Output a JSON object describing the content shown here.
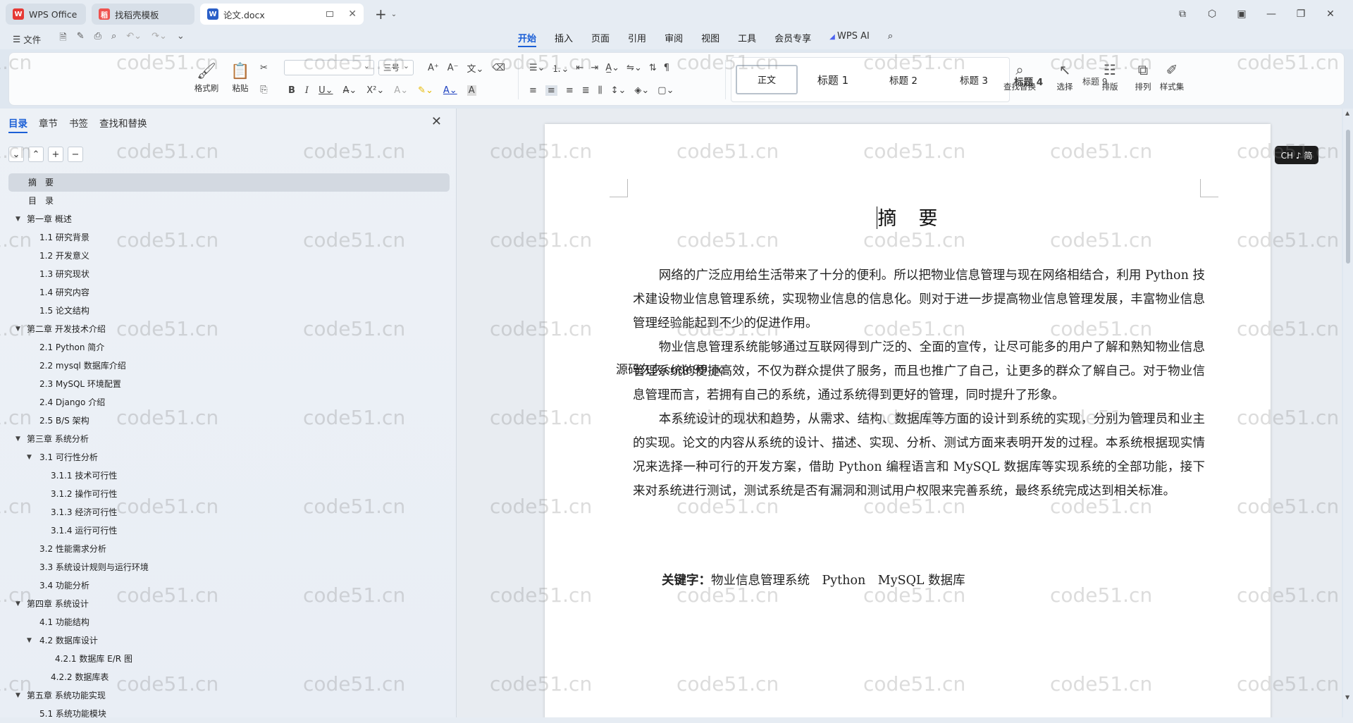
{
  "tabs": [
    {
      "label": "WPS Office",
      "icon": "wps-logo-icon"
    },
    {
      "label": "找稻壳模板",
      "icon": "daoke-logo-icon"
    },
    {
      "label": "论文.docx",
      "icon": "word-doc-icon"
    }
  ],
  "menubar": {
    "file_label": "文件",
    "menus": [
      "开始",
      "插入",
      "页面",
      "引用",
      "审阅",
      "视图",
      "工具",
      "会员专享"
    ],
    "active_menu": "开始",
    "ai_label": "WPS AI"
  },
  "ribbon": {
    "format_painter": "格式刷",
    "paste": "粘贴",
    "font_size": "三号",
    "styles": [
      "正文",
      "标题 1",
      "标题 2",
      "标题 3",
      "标题 4",
      "标题 9"
    ],
    "find_replace": "查找替换",
    "select": "选择",
    "arrange": "排版",
    "sort": "排列",
    "style_set": "样式集"
  },
  "left_panel": {
    "tabs": [
      "目录",
      "章节",
      "书签",
      "查找和替换"
    ],
    "active_tab": "目录",
    "outline": [
      {
        "label": "摘　要",
        "level": 1,
        "caret": false
      },
      {
        "label": "目　录",
        "level": 1,
        "caret": false
      },
      {
        "label": "第一章 概述",
        "level": 1,
        "caret": true
      },
      {
        "label": "1.1 研究背景",
        "level": 2,
        "caret": false
      },
      {
        "label": "1.2 开发意义",
        "level": 2,
        "caret": false
      },
      {
        "label": "1.3 研究现状",
        "level": 2,
        "caret": false
      },
      {
        "label": "1.4 研究内容",
        "level": 2,
        "caret": false
      },
      {
        "label": "1.5 论文结构",
        "level": 2,
        "caret": false
      },
      {
        "label": "第二章  开发技术介绍",
        "level": 1,
        "caret": true
      },
      {
        "label": "2.1   Python 简介",
        "level": 2,
        "caret": false
      },
      {
        "label": "2.2   mysql 数据库介绍",
        "level": 2,
        "caret": false
      },
      {
        "label": "2.3   MySQL 环境配置",
        "level": 2,
        "caret": false
      },
      {
        "label": "2.4   Django 介绍",
        "level": 2,
        "caret": false
      },
      {
        "label": "2.5   B/S 架构",
        "level": 2,
        "caret": false
      },
      {
        "label": "第三章  系统分析",
        "level": 1,
        "caret": true
      },
      {
        "label": "3.1  可行性分析",
        "level": 2,
        "caret": true
      },
      {
        "label": "3.1.1  技术可行性",
        "level": 3,
        "caret": false
      },
      {
        "label": "3.1.2  操作可行性",
        "level": 3,
        "caret": false
      },
      {
        "label": "3.1.3  经济可行性",
        "level": 3,
        "caret": false
      },
      {
        "label": "3.1.4  运行可行性",
        "level": 3,
        "caret": false
      },
      {
        "label": "3.2 性能需求分析",
        "level": 2,
        "caret": false
      },
      {
        "label": "3.3 系统设计规则与运行环境",
        "level": 2,
        "caret": false
      },
      {
        "label": "3.4 功能分析",
        "level": 2,
        "caret": false
      },
      {
        "label": "第四章  系统设计",
        "level": 1,
        "caret": true
      },
      {
        "label": "4.1 功能结构",
        "level": 2,
        "caret": false
      },
      {
        "label": "4.2  数据库设计",
        "level": 2,
        "caret": true
      },
      {
        "label": "4.2.1  数据库 E/R 图",
        "level": 3,
        "caret": false
      },
      {
        "label": "4.2.2  数据库表",
        "level": 3,
        "caret": false
      },
      {
        "label": "第五章  系统功能实现",
        "level": 1,
        "caret": true
      },
      {
        "label": "5.1 系统功能模块",
        "level": 2,
        "caret": false
      }
    ]
  },
  "document": {
    "title": "摘　要",
    "ime_badge": "CH ♪ 简",
    "paragraphs": [
      "网络的广泛应用给生活带来了十分的便利。所以把物业信息管理与现在网络相结合，利用 Python 技术建设物业信息管理系统，实现物业信息的信息化。则对于进一步提高物业信息管理发展，丰富物业信息管理经验能起到不少的促进作用。",
      "物业信息管理系统能够通过互联网得到广泛的、全面的宣传，让尽可能多的用户了解和熟知物业信息管理系统的便捷高效，不仅为群众提供了服务，而且也推广了自己，让更多的群众了解自己。对于物业信息管理而言，若拥有自己的系统，通过系统得到更好的管理，同时提升了形象。",
      "本系统设计的现状和趋势，从需求、结构、数据库等方面的设计到系统的实现，分别为管理员和业主的实现。论文的内容从系统的设计、描述、实现、分析、测试方面来表明开发的过程。本系统根据现实情况来选择一种可行的开发方案，借助 Python 编程语言和 MySQL 数据库等实现系统的全部功能，接下来对系统进行测试，测试系统是否有漏洞和测试用户权限来完善系统，最终系统完成达到相关标准。"
    ],
    "keywords_label": "关键字：",
    "keywords": "物业信息管理系统　Python　MySQL 数据库",
    "overlay": "源码久久code99.cc"
  },
  "watermark": "code51.cn",
  "colors": {
    "accent": "#1b5fd6",
    "tab_bg": "#e6ecf3",
    "wps_red": "#e53935"
  }
}
